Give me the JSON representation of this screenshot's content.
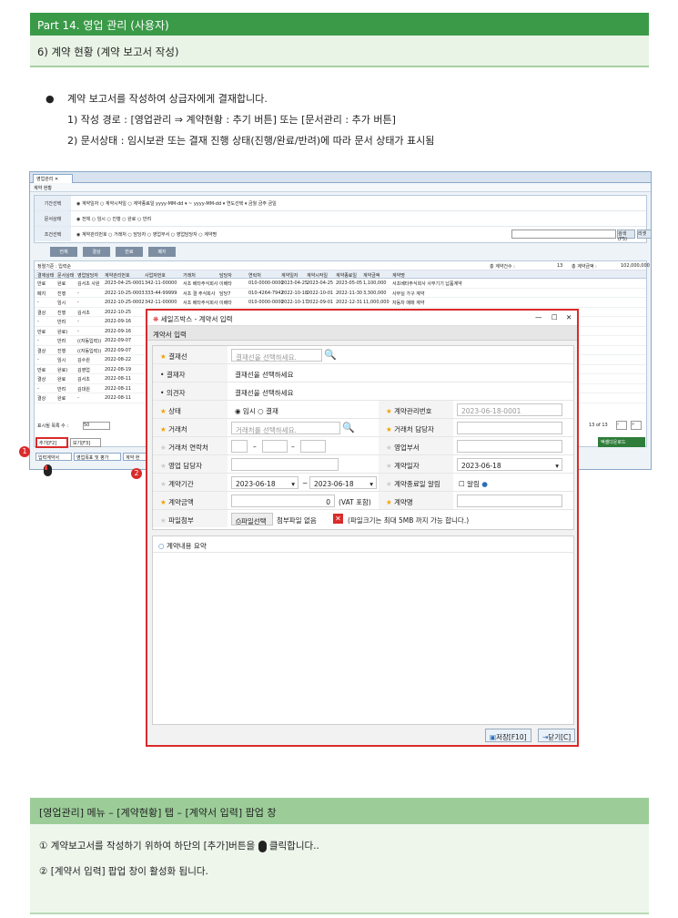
{
  "header": {
    "part": "Part 14. 영업 관리 (사용자)",
    "section": "6) 계약 현황 (계약 보고서 작성)"
  },
  "bullets": {
    "main": "계약 보고서를 작성하여 상급자에게 결재합니다.",
    "item1": "1) 작성 경로 : [영업관리 ⇒ 계약현황 : 추기 버튼] 또는 [문서관리 : 추가 버튼]",
    "item2": "2) 문서상태 : 임시보관 또는 결재 진행 상태(진행/완료/반려)에 따라 문서 상태가 표시됨"
  },
  "app": {
    "tab": "영업관리",
    "crumb": "계약 현황",
    "filters": [
      {
        "label": "기간선택",
        "value": "◉ 계약일자 ○ 계약시작일 ○ 계약종료일   yyyy-MM-dd ▾ ~ yyyy-MM-dd ▾  연도선택 ▾  금월  금주  금일"
      },
      {
        "label": "문서상태",
        "value": "◉ 전체 ○ 임시 ○ 진행 ○ 완료 ○ 반려"
      },
      {
        "label": "조건선택",
        "value": "◉ 계약관리번호 ○ 거래처 ○ 담당자 ○ 영업부서 ○ 영업담당자 ○ 계약명"
      }
    ],
    "search": "검색(F5)",
    "reset": "리셋",
    "state_buttons": [
      "전체",
      "결상",
      "반료",
      "폐지"
    ],
    "list_label": "정렬기준 : 입력순",
    "count_label": "총 계약건수 :",
    "count": "13",
    "amount_label": "총 계약금액 :",
    "amount": "102,000,000",
    "columns": [
      "결재상태",
      "문서상태",
      "영업담당자",
      "계약관리번호",
      "사업자번호",
      "거래처",
      "담당자",
      "연락처",
      "계약일자",
      "계약시작일",
      "계약종료일",
      "계약금액",
      "계약명"
    ],
    "rows": [
      [
        "만료",
        "완료",
        "김서초 사원",
        "2023-04-25-0001",
        "342-11-00000",
        "서초 베타주식회사",
        "이베타",
        "010-0000-0000",
        "2023-04-25",
        "2023-04-25",
        "2023-05-05",
        "1,100,000",
        "서초베타주식회사 사무기기 납품계약"
      ],
      [
        "폐지",
        "진행",
        "-",
        "2022-10-25-0003",
        "333-44-99999",
        "서초 결 주식회사",
        "담당7",
        "010-4264-7942",
        "2022-10-18",
        "2022-10-01",
        "2022-11-30",
        "3,300,000",
        "사무실 가구 계약"
      ],
      [
        "-",
        "임시",
        "-",
        "2022-10-25-0002",
        "342-11-00000",
        "서초 베타주식회사",
        "이베타",
        "010-0000-0000",
        "2022-10-17",
        "2022-09-01",
        "2022-12-31",
        "11,000,000",
        "자동차 매매 계약"
      ],
      [
        "결상",
        "진행",
        "김서초",
        "2022-10-25",
        "",
        "",
        "",
        "",
        "",
        "",
        "",
        "",
        ""
      ],
      [
        "-",
        "반려",
        "-",
        "2022-09-16",
        "",
        "",
        "",
        "",
        "",
        "",
        "",
        "",
        ""
      ],
      [
        "만료",
        "완료)",
        "-",
        "2022-09-16",
        "",
        "",
        "",
        "",
        "",
        "",
        "",
        "",
        ""
      ],
      [
        "-",
        "반려",
        "((자동입력))",
        "2022-09-07",
        "",
        "",
        "",
        "",
        "",
        "",
        "",
        "",
        ""
      ],
      [
        "결상",
        "진행",
        "((자동입력))",
        "2022-09-07",
        "",
        "",
        "",
        "",
        "",
        "",
        "",
        "",
        ""
      ],
      [
        "-",
        "임시",
        "김수원",
        "2022-08-22",
        "",
        "",
        "",
        "",
        "",
        "",
        "",
        "",
        ""
      ],
      [
        "만료",
        "완료)",
        "김영업",
        "2022-08-19",
        "",
        "",
        "",
        "",
        "",
        "",
        "",
        "",
        ""
      ],
      [
        "결상",
        "완료",
        "김서초",
        "2022-08-11",
        "",
        "",
        "",
        "",
        "",
        "",
        "",
        "",
        ""
      ],
      [
        "-",
        "반려",
        "김대원",
        "2022-08-11",
        "",
        "",
        "",
        "",
        "",
        "",
        "",
        "",
        ""
      ],
      [
        "결상",
        "완료",
        "-",
        "2022-08-11",
        "",
        "",
        "",
        "",
        "",
        "",
        "",
        "",
        ""
      ]
    ],
    "page_size_label": "표시될 목록 수 :",
    "page_size": "50",
    "paging": "13 of 13",
    "add_button": "추가[F2]",
    "view_button": "보기[F3]",
    "bottom_tabs": [
      "입력계약서",
      "영업목표 및 평가",
      "계약 현"
    ],
    "excel": "엑셀다운로드"
  },
  "popup": {
    "title": "세일즈박스 - 계약서 입력",
    "section": "계약서 입력",
    "approver_label": "결재선",
    "approver_placeholder": "결재선을 선택하세요.",
    "approver2_label": "결재자",
    "approver2_value": "결재선을 선택하세요",
    "reviewer_label": "의견자",
    "reviewer_value": "결재선을 선택하세요",
    "status_label": "상태",
    "status_value": "◉ 임시 ○ 결재",
    "mgmt_no_label": "계약관리번호",
    "mgmt_no": "2023-06-18-0001",
    "client_label": "거래처",
    "client_placeholder": "거래처를 선택하세요.",
    "client_manager_label": "거래처 담당자",
    "client_contact_label": "거래처 연락처",
    "dash": "–",
    "dept_label": "영업부서",
    "sales_manager_label": "영업 담당자",
    "contract_date_label": "계약일자",
    "contract_date": "2023-06-18",
    "period_label": "계약기간",
    "period_start": "2023-06-18",
    "period_end": "2023-06-18",
    "tilde": "~",
    "end_alert_label": "계약종료일 알림",
    "alert_check": "알림",
    "amount_label": "계약금액",
    "amount_value": "0",
    "vat": "(VAT 포함)",
    "name_label": "계약명",
    "file_label": "파일첨부",
    "file_button": "파일선택",
    "file_none": "첨부파일 없음",
    "file_note": "(파일크기는 최대 5MB 까지 가능 합니다.)",
    "summary_label": "계약내용 요약",
    "save_button": "저장[F10]",
    "close_button": "닫기[C]"
  },
  "caption": {
    "title": "[영업관리] 메뉴 – [계약현황] 탭 – [계약서 입력] 팝업 창",
    "step1_pre": "①  계약보고서를 작성하기 위하여 하단의 [추가]버튼을",
    "step1_post": "클릭합니다..",
    "step2": "②  [계약서 입력]  팝업 창이 활성화 됩니다."
  },
  "markers": {
    "one": "1",
    "two": "2"
  }
}
